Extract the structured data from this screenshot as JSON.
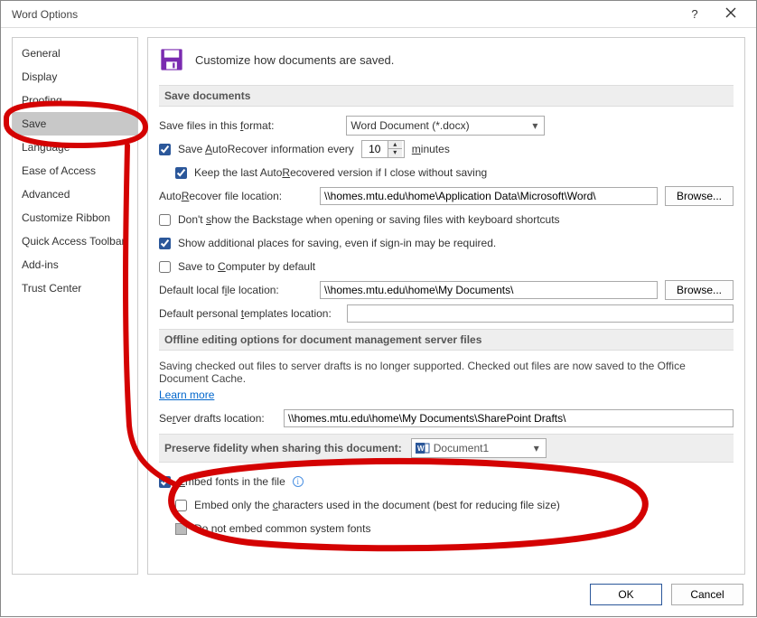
{
  "window": {
    "title": "Word Options"
  },
  "sidebar": {
    "items": [
      "General",
      "Display",
      "Proofing",
      "Save",
      "Language",
      "Ease of Access",
      "Advanced",
      "Customize Ribbon",
      "Quick Access Toolbar",
      "Add-ins",
      "Trust Center"
    ],
    "selected_index": 3
  },
  "header": {
    "headline": "Customize how documents are saved."
  },
  "section_save": {
    "title": "Save documents",
    "format_label": "Save files in this format:",
    "format_value": "Word Document (*.docx)",
    "autorecover_label_pre": "Save ",
    "autorecover_label_mid": "utoRecover information every",
    "autorecover_minutes": "10",
    "autorecover_label_post": "minutes",
    "autorecover_checked": true,
    "keep_last_label": "Keep the last AutoRecovered version if I close without saving",
    "keep_last_checked": true,
    "ar_location_label": "AutoRecover file location:",
    "ar_location_value": "\\\\homes.mtu.edu\\home\\Application Data\\Microsoft\\Word\\",
    "browse_label": "Browse...",
    "dont_show_backstage": "Don't show the Backstage when opening or saving files with keyboard shortcuts",
    "dont_show_backstage_checked": false,
    "show_additional_places": "Show additional places for saving, even if sign-in may be required.",
    "show_additional_places_checked": true,
    "save_to_computer": "Save to Computer by default",
    "save_to_computer_checked": false,
    "default_local_label": "Default local file location:",
    "default_local_value": "\\\\homes.mtu.edu\\home\\My Documents\\",
    "default_templates_label": "Default personal templates location:",
    "default_templates_value": ""
  },
  "section_offline": {
    "title": "Offline editing options for document management server files",
    "note": "Saving checked out files to server drafts is no longer supported. Checked out files are now saved to the Office Document Cache.",
    "learn_more": "Learn more",
    "server_drafts_label": "Server drafts location:",
    "server_drafts_value": "\\\\homes.mtu.edu\\home\\My Documents\\SharePoint Drafts\\"
  },
  "section_preserve": {
    "title": "Preserve fidelity when sharing this document:",
    "doc_value": "Document1",
    "embed_fonts_label": "Embed fonts in the file",
    "embed_fonts_checked": true,
    "embed_only_chars_label": "Embed only the characters used in the document (best for reducing file size)",
    "embed_only_chars_checked": false,
    "do_not_embed_label": "Do not embed common system fonts"
  },
  "footer": {
    "ok": "OK",
    "cancel": "Cancel"
  }
}
